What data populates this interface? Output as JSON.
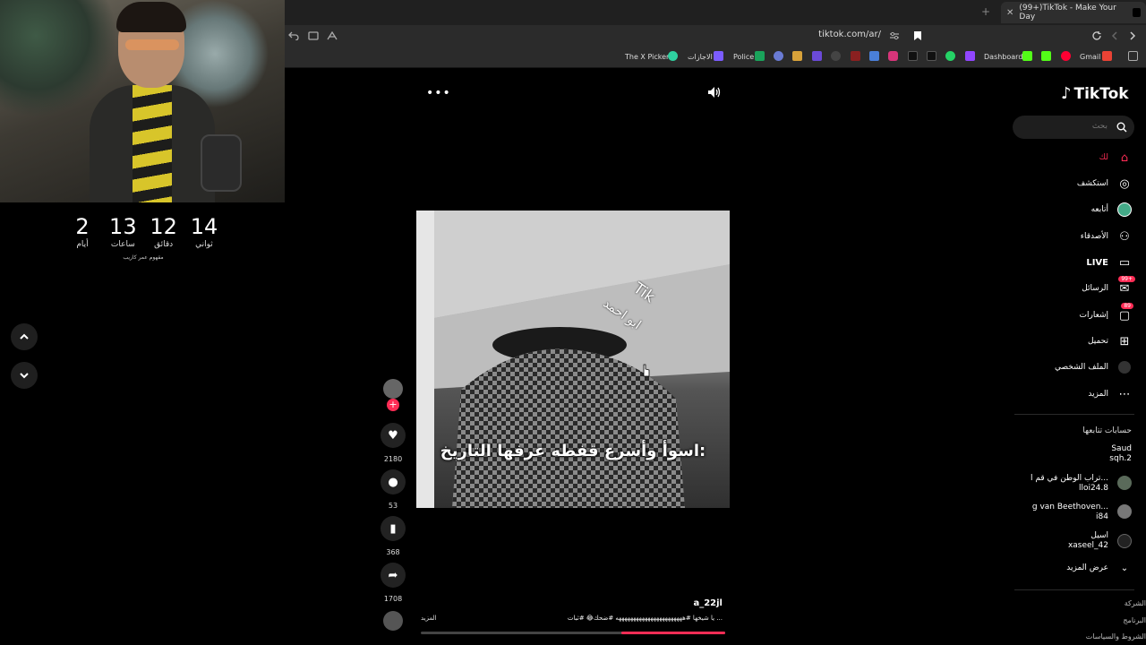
{
  "browser": {
    "tab_title": "(99+)TikTok - Make Your Day",
    "url": "tiktok.com/ar/",
    "bookmarks": {
      "x_picker": "The X Picker",
      "ijazat": "الاجازات",
      "police": "Police",
      "dashboard": "Dashboard",
      "gmail": "Gmail"
    }
  },
  "countdown": {
    "days_value": "2",
    "days_label": "أيام",
    "hours_value": "13",
    "hours_label": "ساعات",
    "minutes_value": "12",
    "minutes_label": "دقائق",
    "seconds_value": "14",
    "seconds_label": "ثواني",
    "footer": "مقهوم عمر كاريب"
  },
  "tiktok": {
    "logo": "TikTok",
    "search_placeholder": "بحث",
    "nav": {
      "for_you": "لك",
      "explore": "استكشف",
      "following": "أتابعه",
      "friends": "الأصدقاء",
      "live": "LIVE",
      "messages": "الرسائل",
      "messages_badge": "99+",
      "notifications": "إشعارات",
      "notifications_badge": "89",
      "upload": "تحميل",
      "profile": "الملف الشخصي",
      "more": "المزيد"
    },
    "following_header": "حسابات تتابعها",
    "following_accounts": [
      {
        "name": "Saud",
        "handle": "sqh.2"
      },
      {
        "name": "تراب الوطن في قم ا...",
        "handle": "lloi24.8"
      },
      {
        "name": "g van Beethoven...",
        "handle": "i84"
      },
      {
        "name": "اسيل",
        "handle": "xaseel_42"
      }
    ],
    "see_more": "عرض المزيد",
    "footer_links": {
      "company": "الشركة",
      "program": "البرنامج",
      "terms": "الشروط والسياسات"
    },
    "actions": {
      "likes": "2180",
      "comments": "53",
      "saves": "368",
      "shares": "1708"
    },
    "video": {
      "watermark_brand": "Tik",
      "watermark_user": "ابو احمد",
      "caption_overlay": "اسوأ وأسرع قفطه عرفها التاريخ:",
      "author": "a_22jl",
      "description": "يا شيخها #هههههههههههههههههههههههه #ضحك😂 #ثبات ...",
      "more_label": "المزيد",
      "progress": 0.34
    }
  }
}
